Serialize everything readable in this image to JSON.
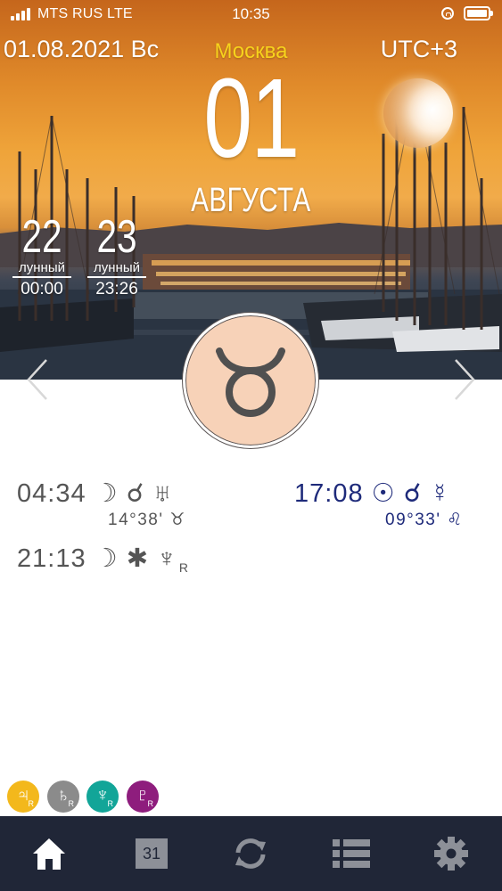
{
  "status_bar": {
    "carrier": "MTS RUS  LTE",
    "time": "10:35"
  },
  "header": {
    "date": "01.08.2021 Вс",
    "city": "Москва",
    "timezone": "UTC+3"
  },
  "day": {
    "number": "01",
    "month": "АВГУСТА"
  },
  "lunar_days": [
    {
      "number": "22",
      "label": "лунный",
      "time": "00:00"
    },
    {
      "number": "23",
      "label": "лунный",
      "time": "23:26"
    }
  ],
  "zodiac": {
    "sign": "Taurus",
    "icon": "taurus-icon"
  },
  "aspects": [
    {
      "time": "04:34",
      "symbols": "☽ ☌ ♅",
      "position": "14°38' ♉",
      "color": "#555555"
    },
    {
      "time": "17:08",
      "symbols": "☉ ☌ ☿",
      "position": "09°33' ♌",
      "color": "#1e2a7a"
    },
    {
      "time": "21:13",
      "symbols": "☽ ✱ ♆",
      "suffix": "R",
      "color": "#555555"
    }
  ],
  "retrograde_planets": [
    {
      "symbol": "♃",
      "suffix": "R",
      "color": "#f3b81c"
    },
    {
      "symbol": "♄",
      "suffix": "R",
      "color": "#8b8b8b"
    },
    {
      "symbol": "♆",
      "suffix": "R",
      "color": "#12a598"
    },
    {
      "symbol": "♇",
      "suffix": "R",
      "color": "#8e1d7d"
    }
  ],
  "tabbar": {
    "calendar_day": "31",
    "tabs": [
      "home-icon",
      "calendar-icon",
      "refresh-icon",
      "list-icon",
      "gear-icon"
    ]
  }
}
